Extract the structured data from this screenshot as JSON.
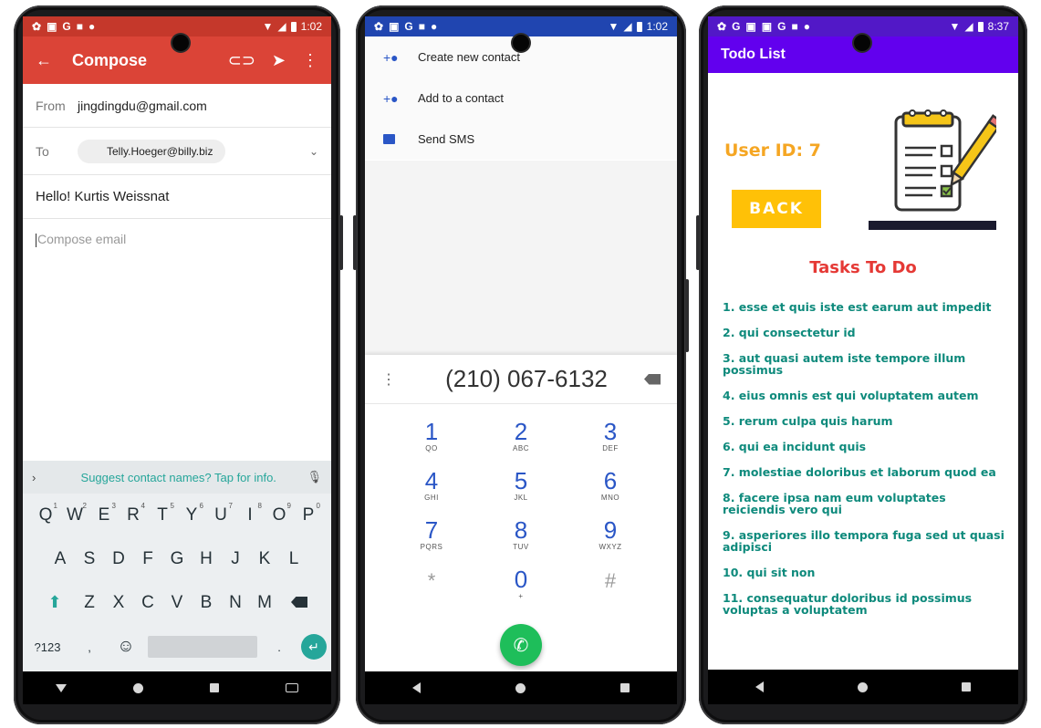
{
  "phones": {
    "gmail": {
      "status_time": "1:02",
      "appbar_title": "Compose",
      "from_label": "From",
      "from_value": "jingdingdu@gmail.com",
      "to_label": "To",
      "to_chip": "Telly.Hoeger@billy.biz",
      "subject": "Hello! Kurtis Weissnat",
      "body_placeholder": "Compose email",
      "keyboard": {
        "suggestion": "Suggest contact names? Tap for info.",
        "row1": [
          "Q",
          "W",
          "E",
          "R",
          "T",
          "Y",
          "U",
          "I",
          "O",
          "P"
        ],
        "row1_hints": [
          "1",
          "2",
          "3",
          "4",
          "5",
          "6",
          "7",
          "8",
          "9",
          "0"
        ],
        "row2": [
          "A",
          "S",
          "D",
          "F",
          "G",
          "H",
          "J",
          "K",
          "L"
        ],
        "row3": [
          "Z",
          "X",
          "C",
          "V",
          "B",
          "N",
          "M"
        ],
        "sym_key": "?123",
        "comma_key": ",",
        "period_key": "."
      }
    },
    "dialer": {
      "status_time": "1:02",
      "menu": [
        {
          "label": "Create new contact",
          "icon": "add-person-icon"
        },
        {
          "label": "Add to a contact",
          "icon": "add-person-icon"
        },
        {
          "label": "Send SMS",
          "icon": "message-icon"
        }
      ],
      "number": "(210) 067-6132",
      "keys": [
        {
          "digit": "1",
          "letters": "QO"
        },
        {
          "digit": "2",
          "letters": "ABC"
        },
        {
          "digit": "3",
          "letters": "DEF"
        },
        {
          "digit": "4",
          "letters": "GHI"
        },
        {
          "digit": "5",
          "letters": "JKL"
        },
        {
          "digit": "6",
          "letters": "MNO"
        },
        {
          "digit": "7",
          "letters": "PQRS"
        },
        {
          "digit": "8",
          "letters": "TUV"
        },
        {
          "digit": "9",
          "letters": "WXYZ"
        },
        {
          "digit": "*",
          "letters": ""
        },
        {
          "digit": "0",
          "letters": "+"
        },
        {
          "digit": "#",
          "letters": ""
        }
      ]
    },
    "todo": {
      "status_time": "8:37",
      "appbar_title": "Todo List",
      "user_id": "User ID: 7",
      "back_label": "BACK",
      "tasks_title": "Tasks To Do",
      "tasks": [
        "1.  esse et quis iste est earum aut impedit",
        "2.  qui consectetur id",
        "3.  aut quasi autem iste tempore illum possimus",
        "4.  eius omnis est qui voluptatem autem",
        "5.  rerum culpa quis harum",
        "6.  qui ea incidunt quis",
        "7.  molestiae doloribus et laborum quod ea",
        "8.  facere ipsa nam eum voluptates reiciendis vero qui",
        "9.  asperiores illo tempora fuga sed ut quasi adipisci",
        "10.  qui sit non",
        "11.  consequatur doloribus id possimus voluptas a voluptatem"
      ]
    }
  },
  "colors": {
    "gmail_appbar": "#db4437",
    "dialer_status": "#2045b0",
    "todo_appbar": "#6200ee",
    "todo_task": "#0e8a7c",
    "todo_title": "#e53935",
    "user_id": "#f5a623",
    "back_button": "#ffc107",
    "call_button": "#1ebe5a"
  }
}
